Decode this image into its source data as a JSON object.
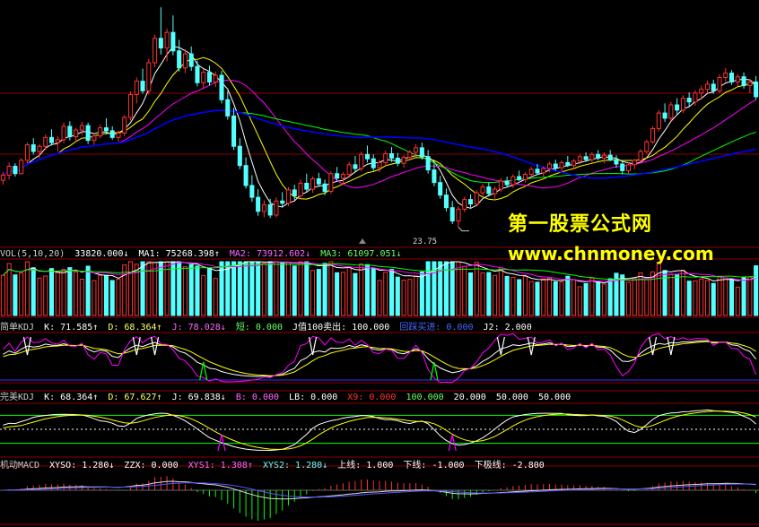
{
  "watermark": {
    "cn": "第一股票公式网",
    "url": "www.chnmoney.com"
  },
  "price_panel": {
    "low_label": "23.75"
  },
  "vol_header": {
    "title": "VOL(5,10,20)",
    "vol": "33820.000↓",
    "ma1": "MA1: 75268.398↑",
    "ma2": "MA2: 73912.602↓",
    "ma3": "MA3: 61097.051↓"
  },
  "kdj1_header": {
    "title": "简单KDJ",
    "k": "K: 71.585↑",
    "d": "D: 68.364↑",
    "j": "J: 78.028↓",
    "short": "短: 0.000",
    "j100": "J值100卖出: 100.000",
    "bottom": "回踩买进: 0.000",
    "j2": "J2: 2.000"
  },
  "kdj2_header": {
    "title": "完美KDJ",
    "k": "K: 68.364↑",
    "d": "D: 67.627↑",
    "j": "J: 69.838↓",
    "b": "B: 0.000",
    "lb": "LB: 0.000",
    "x9": "X9: 0.000",
    "v100": "100.000",
    "v20": "20.000",
    "v50a": "50.000",
    "v50b": "50.000"
  },
  "macd_header": {
    "title": "机动MACD",
    "xyso": "XYSO: 1.280↓",
    "zzx": "ZZX: 0.000",
    "xys1": "XYS1: 1.308↑",
    "xys2": "XYS2: 1.280↓",
    "upper": "上线: 1.000",
    "lower": "下线: -1.000",
    "lowest": "下极线: -2.800"
  },
  "colors": {
    "up": "#ff3232",
    "down": "#54ffff",
    "ma_white": "#ffffff",
    "ma_yellow": "#ffff00",
    "ma_purple": "#ff00ff",
    "ma_green": "#00ff00",
    "ma_blue": "#0000ff",
    "grid_red": "#8b0000"
  },
  "chart_data": {
    "type": "candlestick",
    "price_range": [
      22,
      54
    ],
    "low_marker": 23.75,
    "candles": [
      [
        30.1,
        31.2,
        29.5,
        30.8
      ],
      [
        30.8,
        32.5,
        30.2,
        32.0
      ],
      [
        32.0,
        32.4,
        30.6,
        31.0
      ],
      [
        31.0,
        33.1,
        30.9,
        32.8
      ],
      [
        32.8,
        35.2,
        32.4,
        34.9
      ],
      [
        34.9,
        35.8,
        33.6,
        34.0
      ],
      [
        34.0,
        35.0,
        33.1,
        34.7
      ],
      [
        34.7,
        36.3,
        34.2,
        35.9
      ],
      [
        35.9,
        37.0,
        34.8,
        35.2
      ],
      [
        35.2,
        36.1,
        34.0,
        35.6
      ],
      [
        35.6,
        37.9,
        35.1,
        37.4
      ],
      [
        37.4,
        38.1,
        35.5,
        36.0
      ],
      [
        36.0,
        37.2,
        35.2,
        36.9
      ],
      [
        36.9,
        38.0,
        36.2,
        37.5
      ],
      [
        37.5,
        37.9,
        35.0,
        35.5
      ],
      [
        35.5,
        36.4,
        34.9,
        36.1
      ],
      [
        36.1,
        37.6,
        35.8,
        37.2
      ],
      [
        37.2,
        38.5,
        36.3,
        36.8
      ],
      [
        36.8,
        37.4,
        35.6,
        35.9
      ],
      [
        35.9,
        36.8,
        35.3,
        36.5
      ],
      [
        36.5,
        38.9,
        36.1,
        38.6
      ],
      [
        38.6,
        42.1,
        38.2,
        41.7
      ],
      [
        41.7,
        44.0,
        40.5,
        43.5
      ],
      [
        43.5,
        45.2,
        41.8,
        42.2
      ],
      [
        42.2,
        46.5,
        41.7,
        46.0
      ],
      [
        46.0,
        49.8,
        45.4,
        49.3
      ],
      [
        49.3,
        53.5,
        47.1,
        48.0
      ],
      [
        48.0,
        50.6,
        46.2,
        50.1
      ],
      [
        50.1,
        52.4,
        47.0,
        47.6
      ],
      [
        47.6,
        49.1,
        44.8,
        45.3
      ],
      [
        45.3,
        47.8,
        44.6,
        47.2
      ],
      [
        47.2,
        48.2,
        44.9,
        45.5
      ],
      [
        45.5,
        46.3,
        42.8,
        43.3
      ],
      [
        43.3,
        45.1,
        42.5,
        44.7
      ],
      [
        44.7,
        45.6,
        42.9,
        43.4
      ],
      [
        43.4,
        44.8,
        42.7,
        44.3
      ],
      [
        44.3,
        44.9,
        40.5,
        41.0
      ],
      [
        41.0,
        42.2,
        38.3,
        38.8
      ],
      [
        38.8,
        39.9,
        34.2,
        34.7
      ],
      [
        34.7,
        35.8,
        31.6,
        32.1
      ],
      [
        32.1,
        33.2,
        29.0,
        29.4
      ],
      [
        29.4,
        30.8,
        27.2,
        27.8
      ],
      [
        27.8,
        28.9,
        25.3,
        25.9
      ],
      [
        25.9,
        27.4,
        25.1,
        26.8
      ],
      [
        26.8,
        27.6,
        25.0,
        25.4
      ],
      [
        25.4,
        27.8,
        25.1,
        27.3
      ],
      [
        27.3,
        28.5,
        26.4,
        27.0
      ],
      [
        27.0,
        29.2,
        26.6,
        28.8
      ],
      [
        28.8,
        29.5,
        27.4,
        28.0
      ],
      [
        28.0,
        30.2,
        27.6,
        29.7
      ],
      [
        29.7,
        31.0,
        28.5,
        28.9
      ],
      [
        28.9,
        30.6,
        28.4,
        30.3
      ],
      [
        30.3,
        31.1,
        29.2,
        29.6
      ],
      [
        29.6,
        30.2,
        28.1,
        28.6
      ],
      [
        28.6,
        31.3,
        28.3,
        31.0
      ],
      [
        31.0,
        31.9,
        29.9,
        30.4
      ],
      [
        30.4,
        31.2,
        29.5,
        30.9
      ],
      [
        30.9,
        32.6,
        30.4,
        32.2
      ],
      [
        32.2,
        33.4,
        31.3,
        31.7
      ],
      [
        31.7,
        34.0,
        31.3,
        33.6
      ],
      [
        33.6,
        34.8,
        32.5,
        33.0
      ],
      [
        33.0,
        33.6,
        31.4,
        31.8
      ],
      [
        31.8,
        32.9,
        31.2,
        32.5
      ],
      [
        32.5,
        34.1,
        32.1,
        33.7
      ],
      [
        33.7,
        34.6,
        32.6,
        33.1
      ],
      [
        33.1,
        33.8,
        32.0,
        32.4
      ],
      [
        32.4,
        33.5,
        31.8,
        33.2
      ],
      [
        33.2,
        34.2,
        32.8,
        33.9
      ],
      [
        33.9,
        35.0,
        33.3,
        34.5
      ],
      [
        34.5,
        35.2,
        32.9,
        33.3
      ],
      [
        33.3,
        34.2,
        31.0,
        31.5
      ],
      [
        31.5,
        32.4,
        29.3,
        29.8
      ],
      [
        29.8,
        30.7,
        27.6,
        28.1
      ],
      [
        28.1,
        29.0,
        25.9,
        26.4
      ],
      [
        26.4,
        27.3,
        24.2,
        24.6
      ],
      [
        24.6,
        26.6,
        23.75,
        26.2
      ],
      [
        26.2,
        27.9,
        25.8,
        27.5
      ],
      [
        27.5,
        28.2,
        26.4,
        26.9
      ],
      [
        26.9,
        28.8,
        26.6,
        28.4
      ],
      [
        28.4,
        29.6,
        28.0,
        29.2
      ],
      [
        29.2,
        29.8,
        27.9,
        28.3
      ],
      [
        28.3,
        29.3,
        27.6,
        28.9
      ],
      [
        28.9,
        30.4,
        28.5,
        30.0
      ],
      [
        30.0,
        30.6,
        29.1,
        29.5
      ],
      [
        29.5,
        30.9,
        29.1,
        30.6
      ],
      [
        30.6,
        31.4,
        30.0,
        30.2
      ],
      [
        30.2,
        31.2,
        29.8,
        30.9
      ],
      [
        30.9,
        31.9,
        30.5,
        31.6
      ],
      [
        31.6,
        32.3,
        30.8,
        31.1
      ],
      [
        31.1,
        32.0,
        30.6,
        31.7
      ],
      [
        31.7,
        32.6,
        31.2,
        32.3
      ],
      [
        32.3,
        32.9,
        31.4,
        31.8
      ],
      [
        31.8,
        32.8,
        31.3,
        32.5
      ],
      [
        32.5,
        33.4,
        31.9,
        32.1
      ],
      [
        32.1,
        33.0,
        31.6,
        32.7
      ],
      [
        32.7,
        33.6,
        32.3,
        33.3
      ],
      [
        33.3,
        33.9,
        32.6,
        32.9
      ],
      [
        32.9,
        33.9,
        32.5,
        33.6
      ],
      [
        33.6,
        34.2,
        32.8,
        33.1
      ],
      [
        33.1,
        33.9,
        32.4,
        33.5
      ],
      [
        33.5,
        34.2,
        32.7,
        32.9
      ],
      [
        32.9,
        33.5,
        31.8,
        32.3
      ],
      [
        32.3,
        32.8,
        30.9,
        31.4
      ],
      [
        31.4,
        32.5,
        31.0,
        32.2
      ],
      [
        32.2,
        33.0,
        31.6,
        32.8
      ],
      [
        32.8,
        34.3,
        32.4,
        34.0
      ],
      [
        34.0,
        35.6,
        33.7,
        35.3
      ],
      [
        35.3,
        37.4,
        35.0,
        37.1
      ],
      [
        37.1,
        39.6,
        36.7,
        39.2
      ],
      [
        39.2,
        40.5,
        38.0,
        38.5
      ],
      [
        38.5,
        40.7,
        38.1,
        40.3
      ],
      [
        40.3,
        41.2,
        39.0,
        39.6
      ],
      [
        39.6,
        41.6,
        39.2,
        41.2
      ],
      [
        41.2,
        42.0,
        40.1,
        40.7
      ],
      [
        40.7,
        42.3,
        40.2,
        41.9
      ],
      [
        41.9,
        42.9,
        41.1,
        42.4
      ],
      [
        42.4,
        43.6,
        41.9,
        43.1
      ],
      [
        43.1,
        43.7,
        41.8,
        42.2
      ],
      [
        42.2,
        44.4,
        41.9,
        44.0
      ],
      [
        44.0,
        45.3,
        43.4,
        44.6
      ],
      [
        44.6,
        45.0,
        43.0,
        43.4
      ],
      [
        43.4,
        44.5,
        42.8,
        44.1
      ],
      [
        44.1,
        44.7,
        42.5,
        42.9
      ],
      [
        42.9,
        43.8,
        41.9,
        43.4
      ],
      [
        43.4,
        44.2,
        41.0,
        41.4
      ]
    ]
  }
}
